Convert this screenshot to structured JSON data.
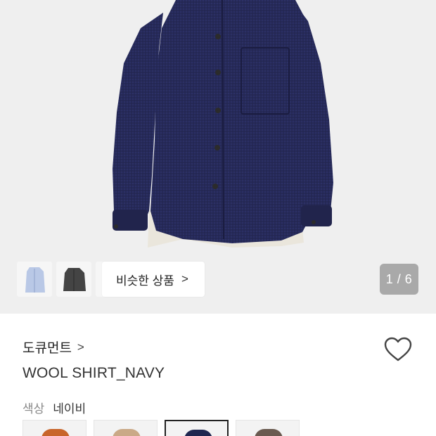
{
  "gallery": {
    "similar_label": "비슷한 상품",
    "similar_chevron": ">",
    "counter": "1 / 6",
    "thumbnails": [
      {
        "name": "light-blue-shirt",
        "color": "#b9c8e6"
      },
      {
        "name": "dark-gray-shirt",
        "color": "#444444"
      },
      {
        "name": "blue-shirt",
        "color": "#9fb4d8"
      }
    ]
  },
  "product": {
    "brand": "도큐먼트",
    "brand_chevron": ">",
    "title": "WOOL SHIRT_NAVY",
    "color_label": "색상",
    "color_value": "네이비",
    "swatches": [
      {
        "name": "orange",
        "color": "#c8652a",
        "selected": false
      },
      {
        "name": "beige",
        "color": "#caa987",
        "selected": false
      },
      {
        "name": "navy",
        "color": "#1f2750",
        "selected": true
      },
      {
        "name": "brown",
        "color": "#6a5a50",
        "selected": false
      }
    ]
  },
  "icons": {
    "heart": "heart-icon",
    "chevron": "chevron-right-icon"
  }
}
